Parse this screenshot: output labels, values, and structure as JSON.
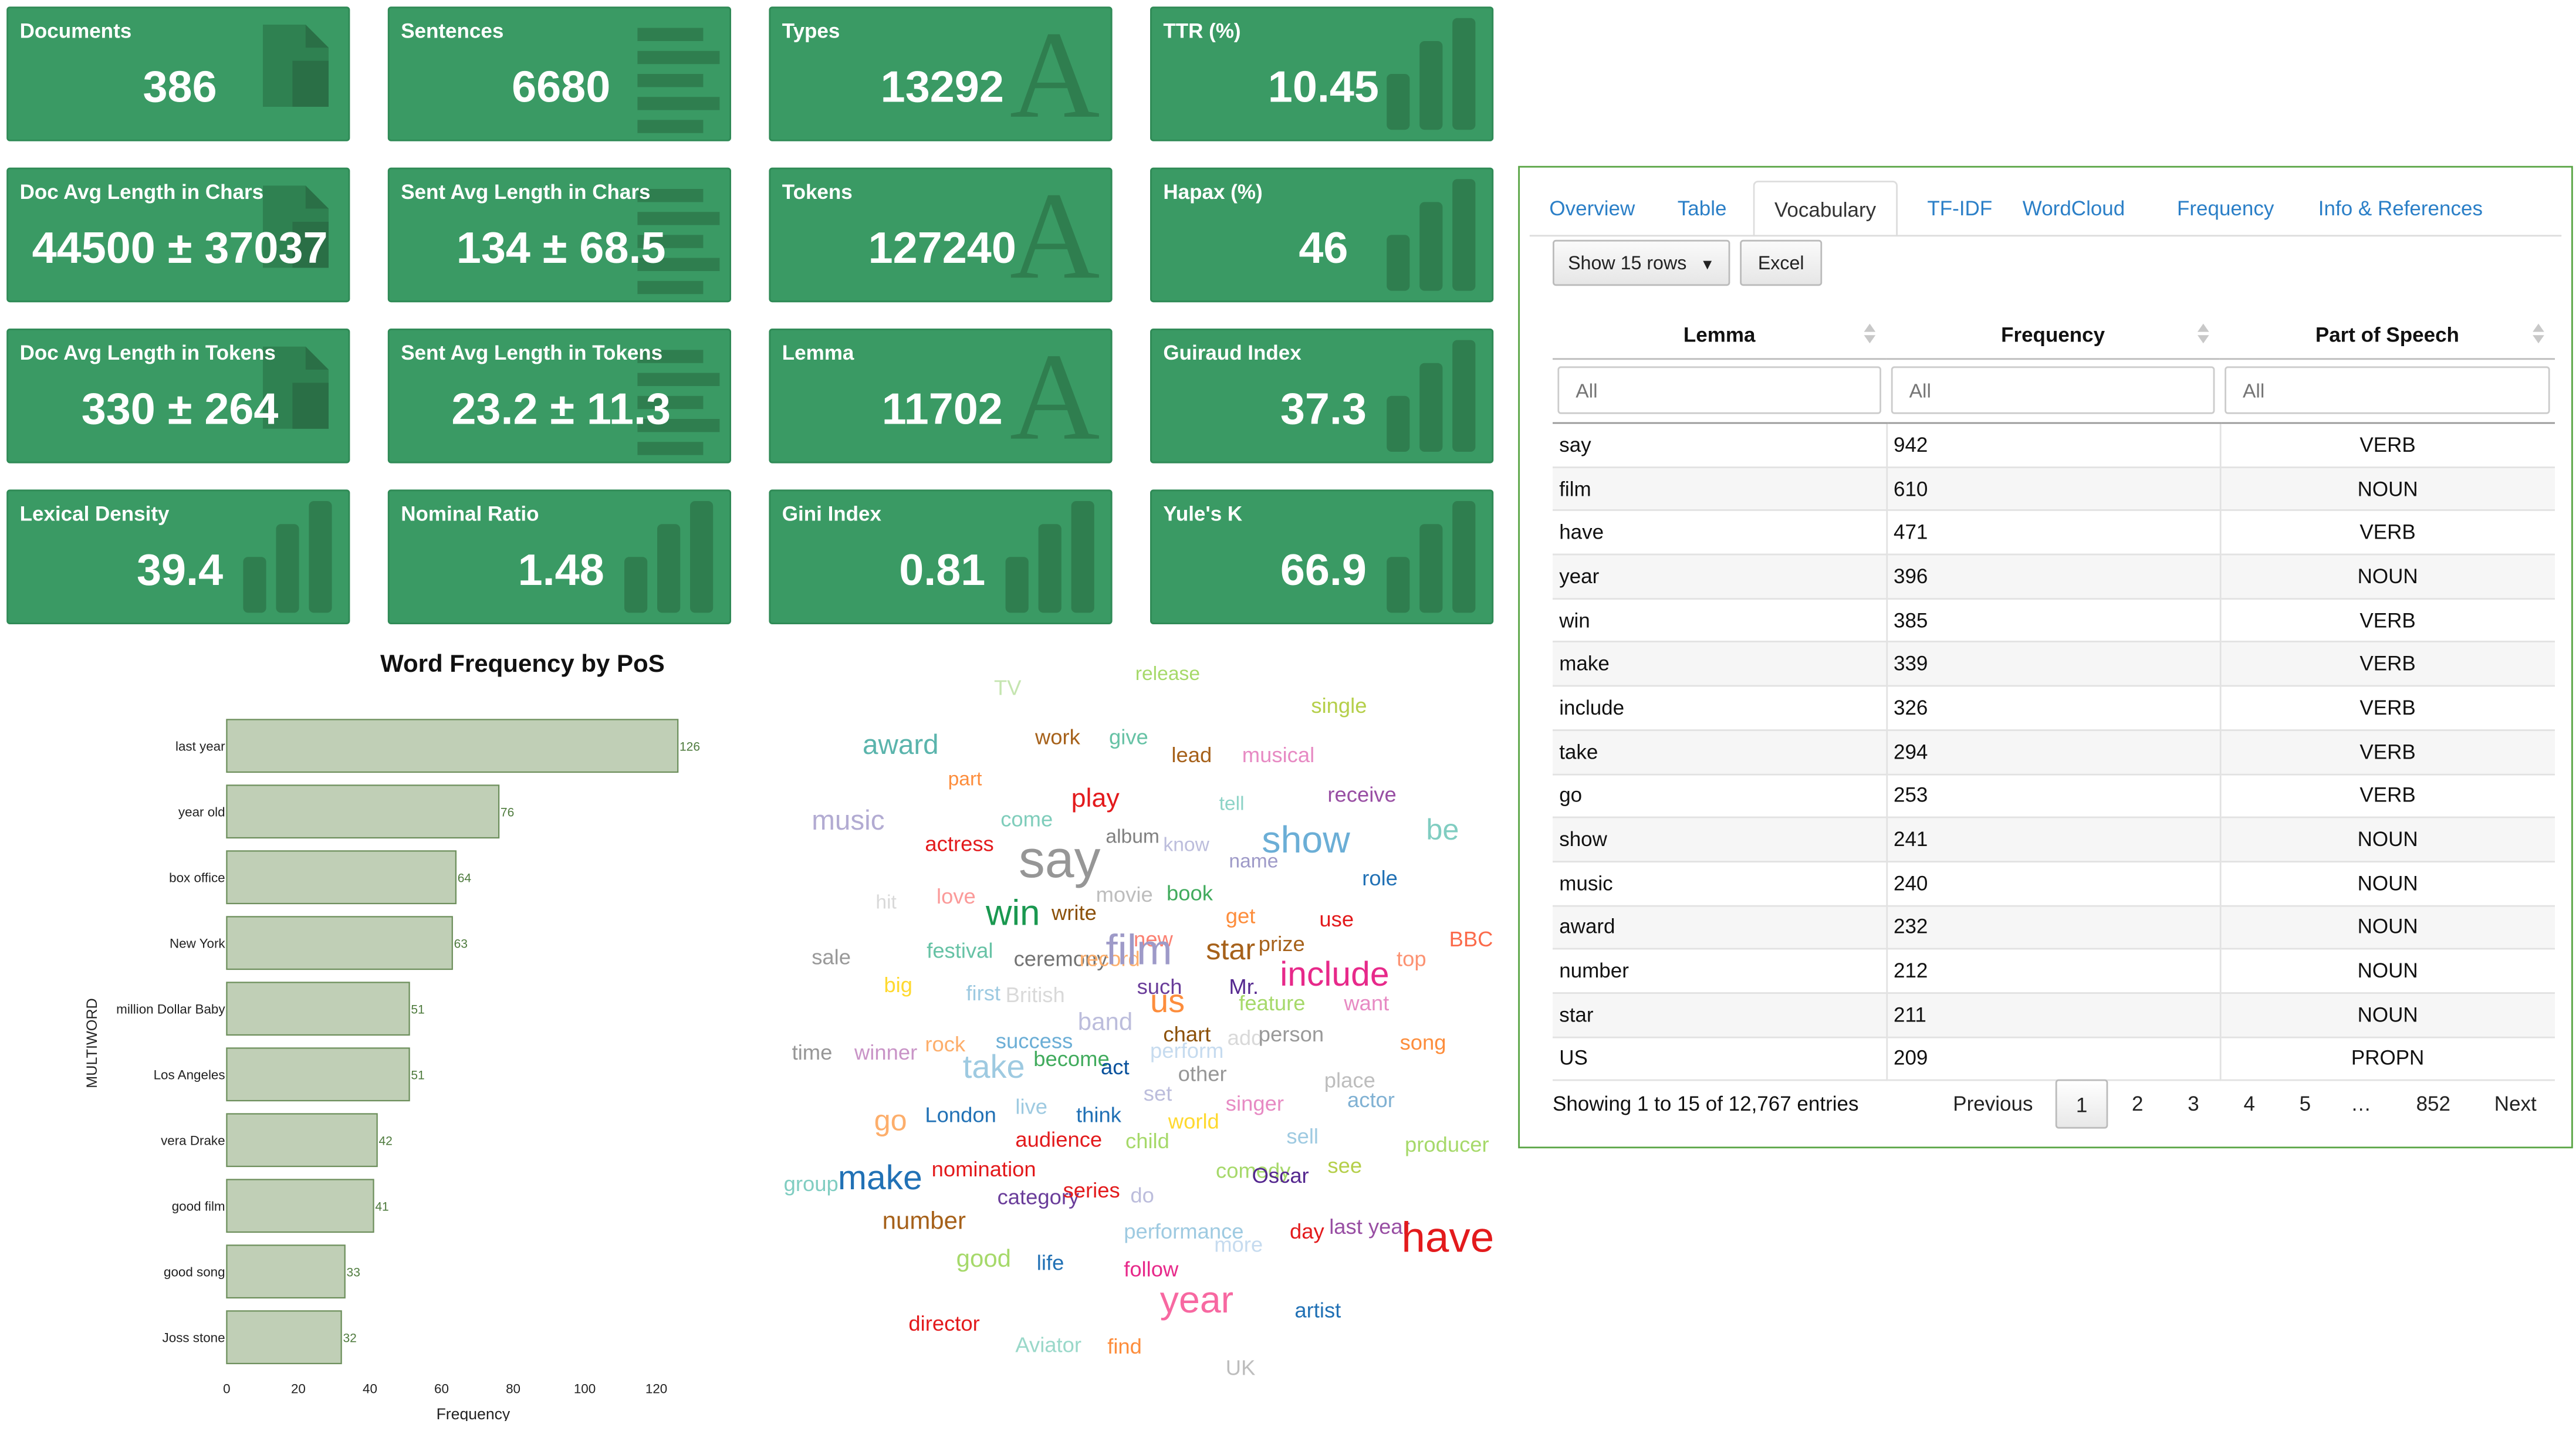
{
  "cards": [
    {
      "label": "Documents",
      "value": "386",
      "icon": "document-icon"
    },
    {
      "label": "Sentences",
      "value": "6680",
      "icon": "text-lines-icon"
    },
    {
      "label": "Types",
      "value": "13292",
      "icon": "letter-a-icon"
    },
    {
      "label": "TTR (%)",
      "value": "10.45",
      "icon": "bar-chart-icon"
    },
    {
      "label": "Doc Avg Length in Chars",
      "value": "44500 ± 37037",
      "icon": "document-icon"
    },
    {
      "label": "Sent Avg Length in Chars",
      "value": "134 ± 68.5",
      "icon": "text-lines-icon"
    },
    {
      "label": "Tokens",
      "value": "127240",
      "icon": "letter-a-icon"
    },
    {
      "label": "Hapax (%)",
      "value": "46",
      "icon": "bar-chart-icon"
    },
    {
      "label": "Doc Avg Length in Tokens",
      "value": "330 ± 264",
      "icon": "document-icon"
    },
    {
      "label": "Sent Avg Length in Tokens",
      "value": "23.2 ± 11.3",
      "icon": "text-lines-icon"
    },
    {
      "label": "Lemma",
      "value": "11702",
      "icon": "letter-a-icon"
    },
    {
      "label": "Guiraud Index",
      "value": "37.3",
      "icon": "bar-chart-icon"
    },
    {
      "label": "Lexical Density",
      "value": "39.4",
      "icon": "bar-chart-icon"
    },
    {
      "label": "Nominal Ratio",
      "value": "1.48",
      "icon": "bar-chart-icon"
    },
    {
      "label": "Gini Index",
      "value": "0.81",
      "icon": "bar-chart-icon"
    },
    {
      "label": "Yule's K",
      "value": "66.9",
      "icon": "bar-chart-icon"
    }
  ],
  "chart_data": {
    "type": "bar",
    "orientation": "horizontal",
    "title": "Word Frequency by PoS",
    "xlabel": "Frequency",
    "ylabel": "MULTIWORD",
    "categories": [
      "last year",
      "year old",
      "box office",
      "New York",
      "million Dollar Baby",
      "Los Angeles",
      "vera Drake",
      "good film",
      "good song",
      "Joss stone"
    ],
    "values": [
      126,
      76,
      64,
      63,
      51,
      51,
      42,
      41,
      33,
      32
    ],
    "xlim": [
      0,
      134
    ],
    "xticks": [
      "0",
      "20",
      "40",
      "60",
      "80",
      "100",
      "120"
    ],
    "bar_color": "#c0cfb6",
    "bar_edge": "#6d8f5c",
    "grid": false
  },
  "wordcloud": {
    "words": [
      {
        "t": "TV",
        "s": 13,
        "c": "#c5e5b0"
      },
      {
        "t": "release",
        "s": 12,
        "c": "#a6d96a"
      },
      {
        "t": "single",
        "s": 13,
        "c": "#b5cf4a"
      },
      {
        "t": "award",
        "s": 17,
        "c": "#5ab4ac"
      },
      {
        "t": "work",
        "s": 13,
        "c": "#a6611a"
      },
      {
        "t": "give",
        "s": 13,
        "c": "#66c2a5"
      },
      {
        "t": "lead",
        "s": 13,
        "c": "#a6611a"
      },
      {
        "t": "musical",
        "s": 13,
        "c": "#e78ac3"
      },
      {
        "t": "part",
        "s": 12,
        "c": "#fd8d3c"
      },
      {
        "t": "music",
        "s": 17,
        "c": "#b2abd2"
      },
      {
        "t": "come",
        "s": 13,
        "c": "#7fcdbb"
      },
      {
        "t": "play",
        "s": 16,
        "c": "#e31a1c"
      },
      {
        "t": "tell",
        "s": 12,
        "c": "#8dd3c7"
      },
      {
        "t": "receive",
        "s": 13,
        "c": "#984ea3"
      },
      {
        "t": "be",
        "s": 18,
        "c": "#80cdc1"
      },
      {
        "t": "actress",
        "s": 13,
        "c": "#e31a1c"
      },
      {
        "t": "album",
        "s": 12,
        "c": "#7f7f7f"
      },
      {
        "t": "know",
        "s": 12,
        "c": "#bcbddc"
      },
      {
        "t": "show",
        "s": 23,
        "c": "#6baed6"
      },
      {
        "t": "say",
        "s": 32,
        "c": "#969696"
      },
      {
        "t": "name",
        "s": 12,
        "c": "#9e9ac8"
      },
      {
        "t": "role",
        "s": 13,
        "c": "#2171b5"
      },
      {
        "t": "hit",
        "s": 12,
        "c": "#d9d9d9"
      },
      {
        "t": "love",
        "s": 13,
        "c": "#fb9a99"
      },
      {
        "t": "movie",
        "s": 13,
        "c": "#bdbdbd"
      },
      {
        "t": "book",
        "s": 13,
        "c": "#41ab5d"
      },
      {
        "t": "win",
        "s": 22,
        "c": "#1a9850"
      },
      {
        "t": "write",
        "s": 13,
        "c": "#8c510a"
      },
      {
        "t": "get",
        "s": 13,
        "c": "#fd8d3c"
      },
      {
        "t": "use",
        "s": 13,
        "c": "#e31a1c"
      },
      {
        "t": "BBC",
        "s": 13,
        "c": "#fb6a4a"
      },
      {
        "t": "new",
        "s": 13,
        "c": "#fb8072"
      },
      {
        "t": "prize",
        "s": 13,
        "c": "#a6611a"
      },
      {
        "t": "sale",
        "s": 13,
        "c": "#999999"
      },
      {
        "t": "festival",
        "s": 13,
        "c": "#66c2a5"
      },
      {
        "t": "ceremony",
        "s": 13,
        "c": "#737373"
      },
      {
        "t": "record",
        "s": 13,
        "c": "#fdae6b"
      },
      {
        "t": "film",
        "s": 26,
        "c": "#9e9ac8"
      },
      {
        "t": "star",
        "s": 18,
        "c": "#a6611a"
      },
      {
        "t": "top",
        "s": 13,
        "c": "#fc9272"
      },
      {
        "t": "include",
        "s": 21,
        "c": "#e7298a"
      },
      {
        "t": "big",
        "s": 13,
        "c": "#ffd92f"
      },
      {
        "t": "first",
        "s": 13,
        "c": "#9ecae1"
      },
      {
        "t": "British",
        "s": 13,
        "c": "#d9d9d9"
      },
      {
        "t": "such",
        "s": 13,
        "c": "#6a3d9a"
      },
      {
        "t": "Mr.",
        "s": 13,
        "c": "#54278f"
      },
      {
        "t": "us",
        "s": 20,
        "c": "#fd8d3c"
      },
      {
        "t": "feature",
        "s": 13,
        "c": "#a6d96a"
      },
      {
        "t": "want",
        "s": 13,
        "c": "#e78ac3"
      },
      {
        "t": "band",
        "s": 15,
        "c": "#bcbddc"
      },
      {
        "t": "time",
        "s": 13,
        "c": "#969696"
      },
      {
        "t": "winner",
        "s": 13,
        "c": "#c994c7"
      },
      {
        "t": "rock",
        "s": 13,
        "c": "#fdae6b"
      },
      {
        "t": "success",
        "s": 13,
        "c": "#6baed6"
      },
      {
        "t": "chart",
        "s": 13,
        "c": "#8c510a"
      },
      {
        "t": "add",
        "s": 13,
        "c": "#d9d9d9"
      },
      {
        "t": "person",
        "s": 13,
        "c": "#999999"
      },
      {
        "t": "song",
        "s": 13,
        "c": "#fd8d3c"
      },
      {
        "t": "take",
        "s": 20,
        "c": "#9ecae1"
      },
      {
        "t": "become",
        "s": 13,
        "c": "#41ab5d"
      },
      {
        "t": "perform",
        "s": 13,
        "c": "#c6dbef"
      },
      {
        "t": "act",
        "s": 13,
        "c": "#08519c"
      },
      {
        "t": "other",
        "s": 13,
        "c": "#969696"
      },
      {
        "t": "place",
        "s": 13,
        "c": "#bdbdbd"
      },
      {
        "t": "live",
        "s": 13,
        "c": "#9ecae1"
      },
      {
        "t": "set",
        "s": 13,
        "c": "#bcbddc"
      },
      {
        "t": "actor",
        "s": 13,
        "c": "#80b1d3"
      },
      {
        "t": "singer",
        "s": 13,
        "c": "#e78ac3"
      },
      {
        "t": "go",
        "s": 18,
        "c": "#fdae6b"
      },
      {
        "t": "London",
        "s": 13,
        "c": "#2171b5"
      },
      {
        "t": "think",
        "s": 13,
        "c": "#2171b5"
      },
      {
        "t": "world",
        "s": 13,
        "c": "#ffd92f"
      },
      {
        "t": "audience",
        "s": 13,
        "c": "#e31a1c"
      },
      {
        "t": "child",
        "s": 13,
        "c": "#a6d96a"
      },
      {
        "t": "sell",
        "s": 13,
        "c": "#9ecae1"
      },
      {
        "t": "producer",
        "s": 13,
        "c": "#a6d96a"
      },
      {
        "t": "see",
        "s": 13,
        "c": "#b5cf4a"
      },
      {
        "t": "group",
        "s": 13,
        "c": "#80cdc1"
      },
      {
        "t": "make",
        "s": 21,
        "c": "#2171b5"
      },
      {
        "t": "nomination",
        "s": 13,
        "c": "#e31a1c"
      },
      {
        "t": "comedy",
        "s": 13,
        "c": "#a6d96a"
      },
      {
        "t": "Oscar",
        "s": 13,
        "c": "#54278f"
      },
      {
        "t": "category",
        "s": 13,
        "c": "#6a3d9a"
      },
      {
        "t": "series",
        "s": 13,
        "c": "#e31a1c"
      },
      {
        "t": "do",
        "s": 13,
        "c": "#bcbddc"
      },
      {
        "t": "number",
        "s": 15,
        "c": "#a6611a"
      },
      {
        "t": "performance",
        "s": 13,
        "c": "#9ecae1"
      },
      {
        "t": "more",
        "s": 13,
        "c": "#c6dbef"
      },
      {
        "t": "day",
        "s": 13,
        "c": "#e31a1c"
      },
      {
        "t": "last year",
        "s": 13,
        "c": "#984ea3"
      },
      {
        "t": "have",
        "s": 26,
        "c": "#e31a1c"
      },
      {
        "t": "good",
        "s": 15,
        "c": "#a6d96a"
      },
      {
        "t": "life",
        "s": 13,
        "c": "#2171b5"
      },
      {
        "t": "follow",
        "s": 13,
        "c": "#e7298a"
      },
      {
        "t": "year",
        "s": 23,
        "c": "#f768a1"
      },
      {
        "t": "artist",
        "s": 13,
        "c": "#2171b5"
      },
      {
        "t": "director",
        "s": 13,
        "c": "#e31a1c"
      },
      {
        "t": "Aviator",
        "s": 13,
        "c": "#99d8c9"
      },
      {
        "t": "find",
        "s": 13,
        "c": "#fd8d3c"
      },
      {
        "t": "UK",
        "s": 13,
        "c": "#bdbdbd"
      }
    ]
  },
  "panel": {
    "tabs": [
      "Overview",
      "Table",
      "Vocabulary",
      "TF-IDF",
      "WordCloud",
      "Frequency",
      "Info & References"
    ],
    "active_tab": "Vocabulary",
    "show_rows_label": "Show 15 rows",
    "excel_label": "Excel",
    "columns": [
      "Lemma",
      "Frequency",
      "Part of Speech"
    ],
    "filter_placeholder": "All",
    "rows": [
      [
        "say",
        "942",
        "VERB"
      ],
      [
        "film",
        "610",
        "NOUN"
      ],
      [
        "have",
        "471",
        "VERB"
      ],
      [
        "year",
        "396",
        "NOUN"
      ],
      [
        "win",
        "385",
        "VERB"
      ],
      [
        "make",
        "339",
        "VERB"
      ],
      [
        "include",
        "326",
        "VERB"
      ],
      [
        "take",
        "294",
        "VERB"
      ],
      [
        "go",
        "253",
        "VERB"
      ],
      [
        "show",
        "241",
        "NOUN"
      ],
      [
        "music",
        "240",
        "NOUN"
      ],
      [
        "award",
        "232",
        "NOUN"
      ],
      [
        "number",
        "212",
        "NOUN"
      ],
      [
        "star",
        "211",
        "NOUN"
      ],
      [
        "US",
        "209",
        "PROPN"
      ]
    ],
    "info": "Showing 1 to 15 of 12,767 entries",
    "pagination": {
      "previous": "Previous",
      "pages": [
        "1",
        "2",
        "3",
        "4",
        "5",
        "…",
        "852"
      ],
      "current": "1",
      "next": "Next"
    }
  }
}
